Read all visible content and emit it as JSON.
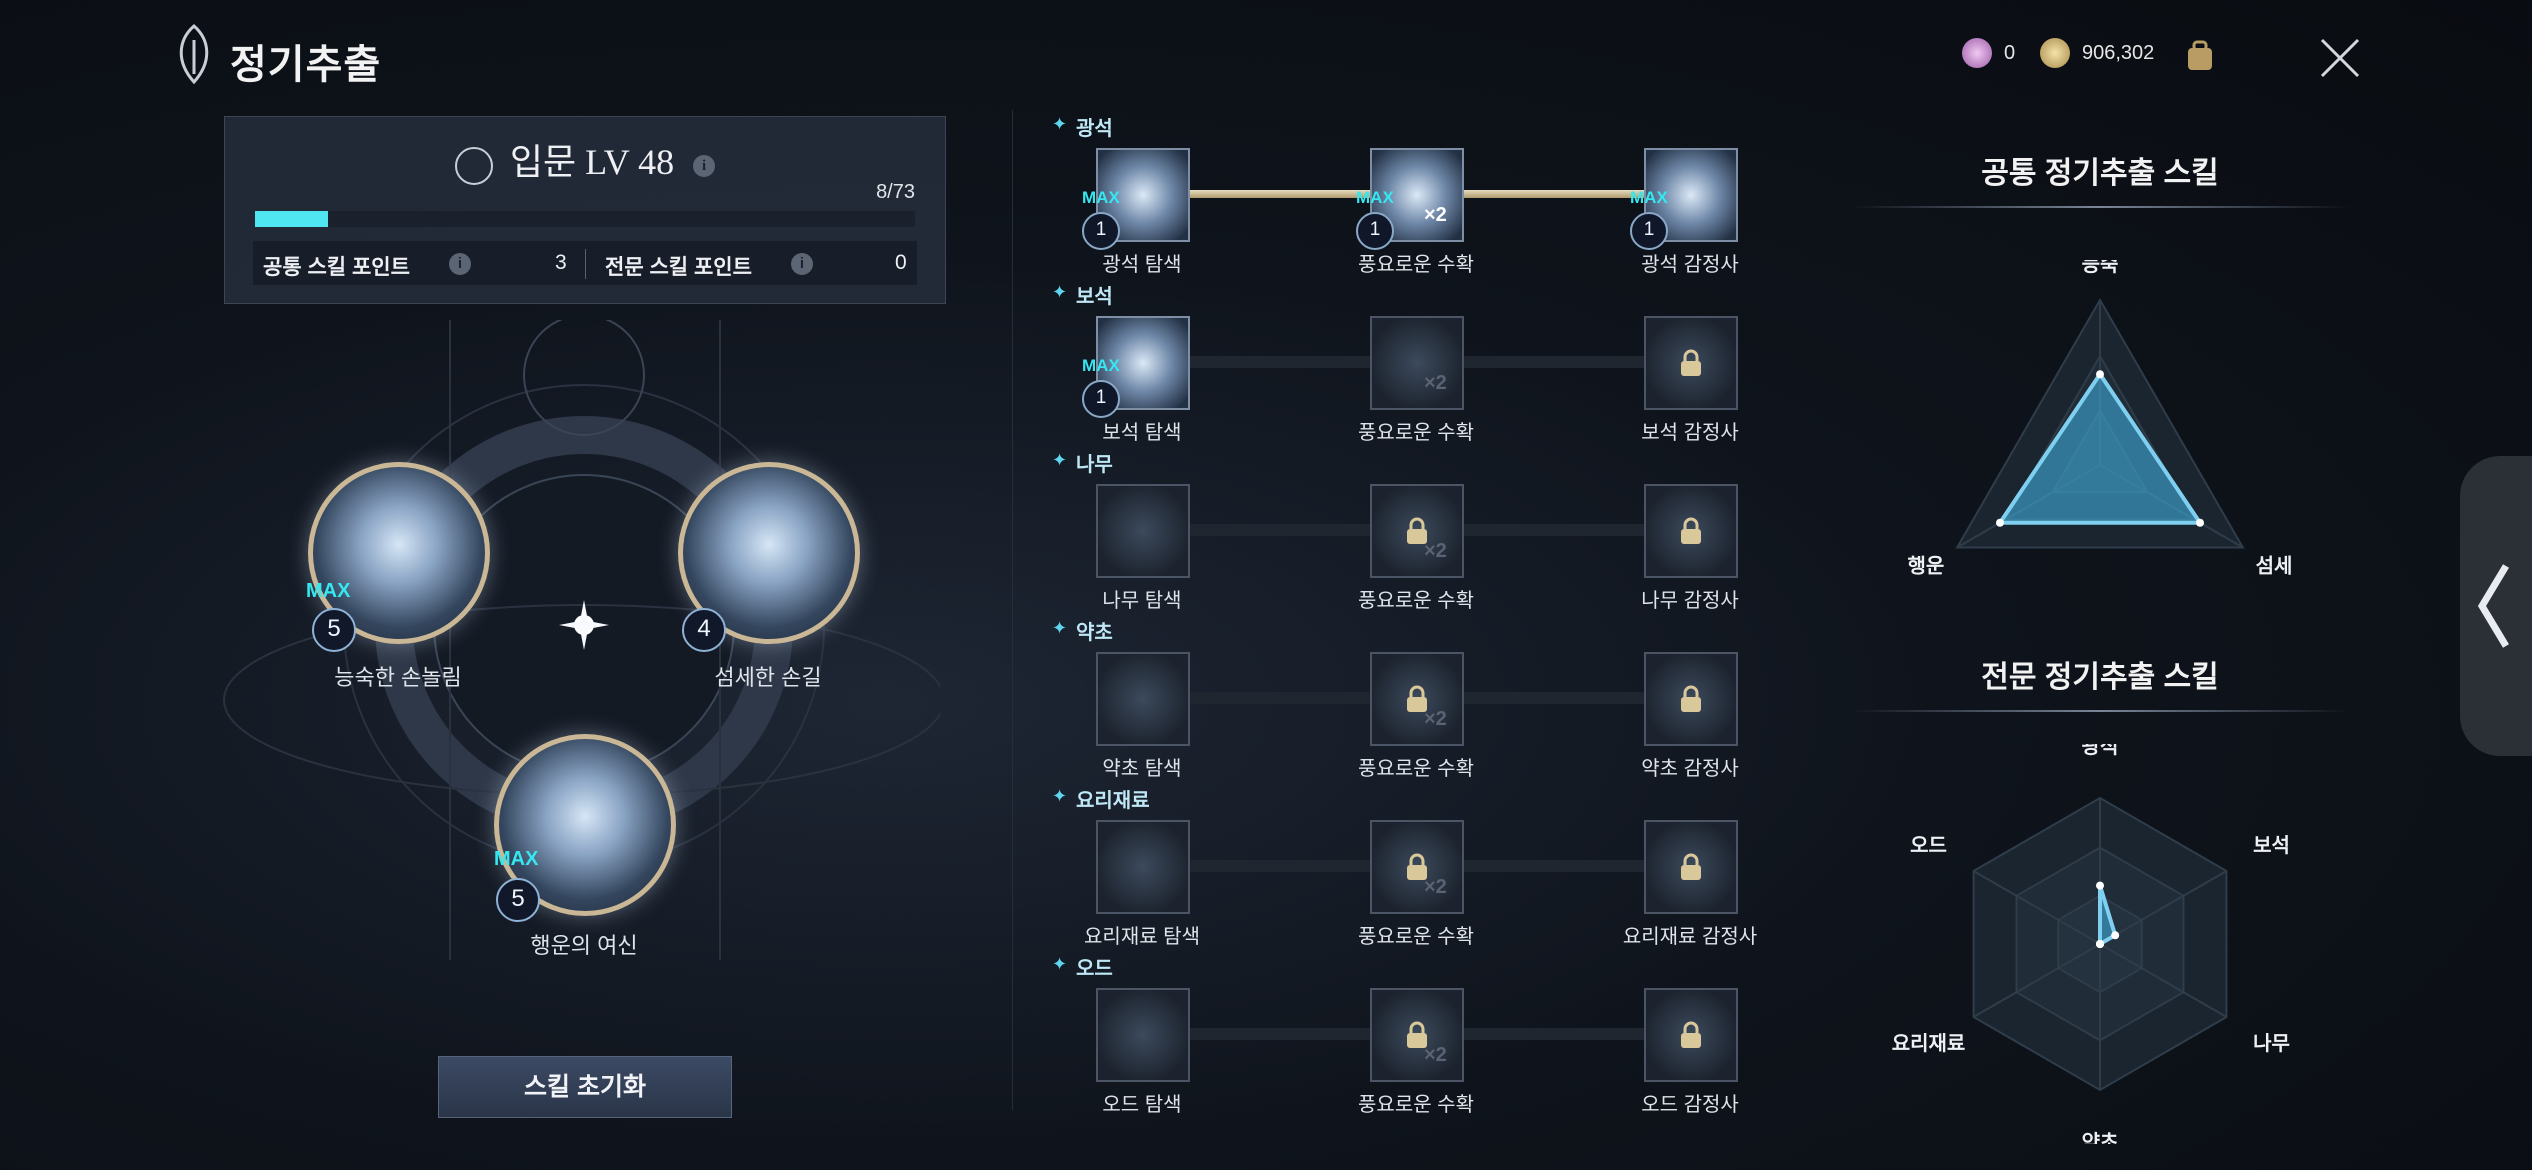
{
  "header": {
    "title": "정기추출",
    "currency1": "0",
    "currency2": "906,302"
  },
  "level": {
    "title": "입문 LV 48",
    "progress_text": "8/73",
    "progress": 0.11,
    "common_label": "공통 스킬 포인트",
    "common_value": "3",
    "expert_label": "전문 스킬 포인트",
    "expert_value": "0"
  },
  "orbs": [
    {
      "label": "능숙한 손놀림",
      "level": "5",
      "max": "MAX"
    },
    {
      "label": "섬세한 손길",
      "level": "4",
      "max": ""
    },
    {
      "label": "행운의 여신",
      "level": "5",
      "max": "MAX"
    }
  ],
  "reset_button": "스킬 초기화",
  "tree": [
    {
      "name": "광석",
      "nodes": [
        {
          "label": "광석 탐색",
          "state": "max",
          "max": "MAX",
          "badge": "1"
        },
        {
          "label": "풍요로운 수확",
          "state": "max",
          "max": "MAX",
          "badge": "1",
          "x2": "×2"
        },
        {
          "label": "광석 감정사",
          "state": "max",
          "max": "MAX",
          "badge": "1"
        }
      ]
    },
    {
      "name": "보석",
      "nodes": [
        {
          "label": "보석 탐색",
          "state": "max",
          "max": "MAX",
          "badge": "1"
        },
        {
          "label": "풍요로운 수확",
          "state": "open",
          "x2": "×2"
        },
        {
          "label": "보석 감정사",
          "state": "locked"
        }
      ]
    },
    {
      "name": "나무",
      "nodes": [
        {
          "label": "나무 탐색",
          "state": "open"
        },
        {
          "label": "풍요로운 수확",
          "state": "locked",
          "x2": "×2"
        },
        {
          "label": "나무 감정사",
          "state": "locked"
        }
      ]
    },
    {
      "name": "약초",
      "nodes": [
        {
          "label": "약초 탐색",
          "state": "open"
        },
        {
          "label": "풍요로운 수확",
          "state": "locked",
          "x2": "×2"
        },
        {
          "label": "약초 감정사",
          "state": "locked"
        }
      ]
    },
    {
      "name": "요리재료",
      "nodes": [
        {
          "label": "요리재료 탐색",
          "state": "open"
        },
        {
          "label": "풍요로운 수확",
          "state": "locked",
          "x2": "×2"
        },
        {
          "label": "요리재료 감정사",
          "state": "locked"
        }
      ]
    },
    {
      "name": "오드",
      "nodes": [
        {
          "label": "오드 탐색",
          "state": "open"
        },
        {
          "label": "풍요로운 수확",
          "state": "locked",
          "x2": "×2"
        },
        {
          "label": "오드 감정사",
          "state": "locked"
        }
      ]
    }
  ],
  "radar_common": {
    "title": "공통 정기추출 스킬",
    "labels": [
      "능숙",
      "섬세",
      "행운"
    ],
    "values": [
      0.55,
      0.7,
      0.7
    ]
  },
  "radar_expert": {
    "title": "전문 정기추출 스킬",
    "labels": [
      "광석",
      "보석",
      "나무",
      "약초",
      "요리재료",
      "오드"
    ],
    "values": [
      0.4,
      0.12,
      0.0,
      0.0,
      0.0,
      0.0
    ]
  },
  "colors": {
    "accent": "#35e8ef",
    "gold": "#c9b796",
    "radar": "#3fb4e6"
  }
}
